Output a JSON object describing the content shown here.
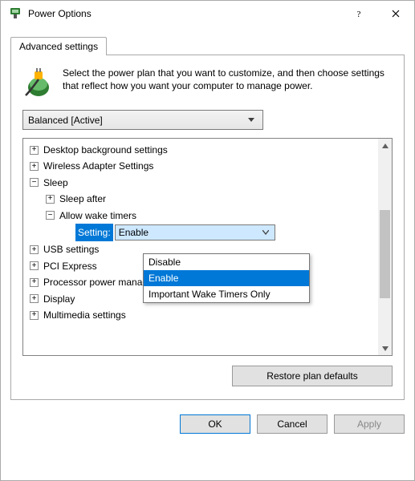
{
  "window": {
    "title": "Power Options"
  },
  "tab": {
    "label": "Advanced settings"
  },
  "intro": "Select the power plan that you want to customize, and then choose settings that reflect how you want your computer to manage power.",
  "plan": {
    "selected": "Balanced [Active]"
  },
  "tree": {
    "items": [
      {
        "label": "Desktop background settings"
      },
      {
        "label": "Wireless Adapter Settings"
      },
      {
        "label": "Sleep"
      },
      {
        "label": "Sleep after"
      },
      {
        "label": "Allow wake timers"
      },
      {
        "label": "USB settings"
      },
      {
        "label": "PCI Express"
      },
      {
        "label": "Processor power management"
      },
      {
        "label": "Display"
      },
      {
        "label": "Multimedia settings"
      }
    ],
    "setting": {
      "label": "Setting:",
      "value": "Enable",
      "options": [
        "Disable",
        "Enable",
        "Important Wake Timers Only"
      ]
    }
  },
  "buttons": {
    "restore": "Restore plan defaults",
    "ok": "OK",
    "cancel": "Cancel",
    "apply": "Apply"
  }
}
